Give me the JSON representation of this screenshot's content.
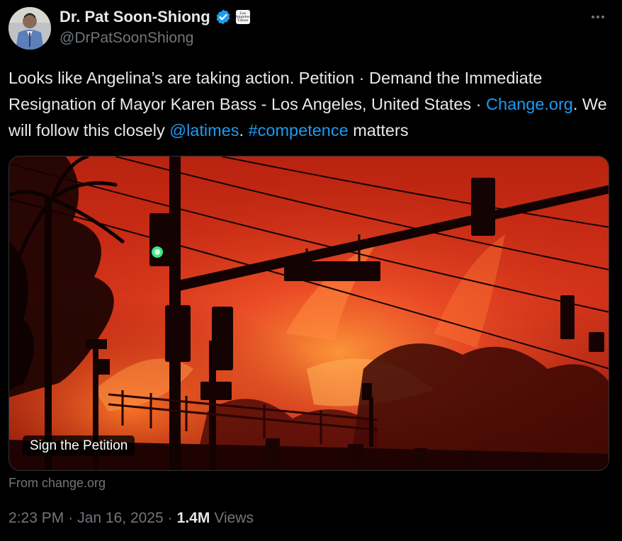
{
  "author": {
    "display_name": "Dr. Pat Soon-Shiong",
    "handle": "@DrPatSoonShiong",
    "affiliation_badge_text": "Los Angeles Times",
    "verified_icon": "verified-badge-icon",
    "avatar_icon": "avatar"
  },
  "tweet": {
    "text_part1": "Looks like Angelina’s are taking action. Petition · Demand the Immediate Resignation of Mayor Karen Bass - Los Angeles, United States · ",
    "link_change": "Change.org",
    "text_part2": ". We will follow this closely ",
    "mention_latimes": "@latimes",
    "text_part3": ". ",
    "hashtag": "#competence",
    "text_part4": " matters"
  },
  "card": {
    "label": "Sign the Petition",
    "source": "From change.org"
  },
  "meta": {
    "time": "2:23 PM",
    "separator": "·",
    "date": "Jan 16, 2025",
    "views_count": "1.4M",
    "views_label": "Views"
  },
  "colors": {
    "background": "#000000",
    "text": "#e7e9ea",
    "secondary": "#71767b",
    "link": "#1d9bf0",
    "verified": "#1d9bf0"
  }
}
